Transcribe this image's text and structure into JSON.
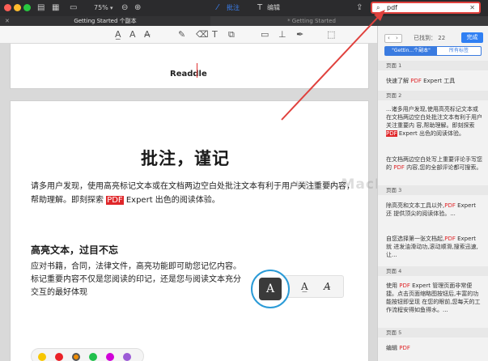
{
  "toolbar": {
    "zoom": "75%",
    "annotate_label": "批注",
    "edit_label": "编辑"
  },
  "search": {
    "value": "pdf"
  },
  "tabs": [
    {
      "label": "Getting Started 个副本"
    },
    {
      "label": "* Getting Started"
    }
  ],
  "document": {
    "brand": "Readdle",
    "title": "批注，谨记",
    "paragraph_a": "请多用户发现，使用高亮标记文本或在文档两边空白处批注文本有利于用户关注重要内容，帮助理解。即刻探索 ",
    "paragraph_highlight": "PDF",
    "paragraph_b": " Expert 出色的阅读体验。",
    "subtitle": "高亮文本，过目不忘",
    "paragraph2": "应对书籍，合同，法律文件，高亮功能即可助您记忆内容。标记重要内容不仅是您阅读的印记，还是您与阅读文本充分交互的最好体现",
    "pen_icon_label": "A"
  },
  "colors": [
    "#f7c600",
    "#ea2127",
    "#f08c00",
    "#21c04c",
    "#d100d8",
    "#9c5bd6"
  ],
  "panel": {
    "found_label": "已找到：",
    "found_count": "22",
    "done_label": "完成",
    "scope_tabs": [
      "\"Gettin...个副本\"",
      "所有标签"
    ],
    "results": [
      {
        "page": "页面 1",
        "text_pre": "快速了解 ",
        "hit": "PDF",
        "text_post": " Expert 工具"
      },
      {
        "page": "页面 2",
        "text_pre": "...诸多用户发现,使用高亮标记文本或在文档两边空白处批注文本有利于用户关注重要内 容,帮助理解。即刻探索 ",
        "hit": "PDF",
        "text_post": " Expert 出色的阅读体验。"
      },
      {
        "page": "",
        "text_pre": "在文档两边空白处写上重要评论手写您的 ",
        "hit": "PDF",
        "text_post": " 内容,您的全部评论都可搜索。"
      },
      {
        "page": "页面 3",
        "text_pre": "除高亮和文本工具以外,",
        "hit": "PDF",
        "text_post": " Expert 还 提供顶尖的阅读体验。..."
      },
      {
        "page": "",
        "text_pre": "自您选择第一张文档起,",
        "hit": "PDF",
        "text_post": " Expert 就 进发油滑动功,滚动顺滑,搜索迅速,让..."
      },
      {
        "page": "页面 4",
        "text_pre": "使用 ",
        "hit": "PDF",
        "text_post": " Expert 管理页面非常便捷。点击页面缩略图按钮后,丰富的功能按钮即呈现 在您的眼前,您每天的工作流程安得如鱼得水。..."
      },
      {
        "page": "页面 5",
        "text_pre": "编辑 ",
        "hit": "PDF",
        "text_post": ""
      }
    ]
  },
  "watermark": "www.MacDown.com"
}
